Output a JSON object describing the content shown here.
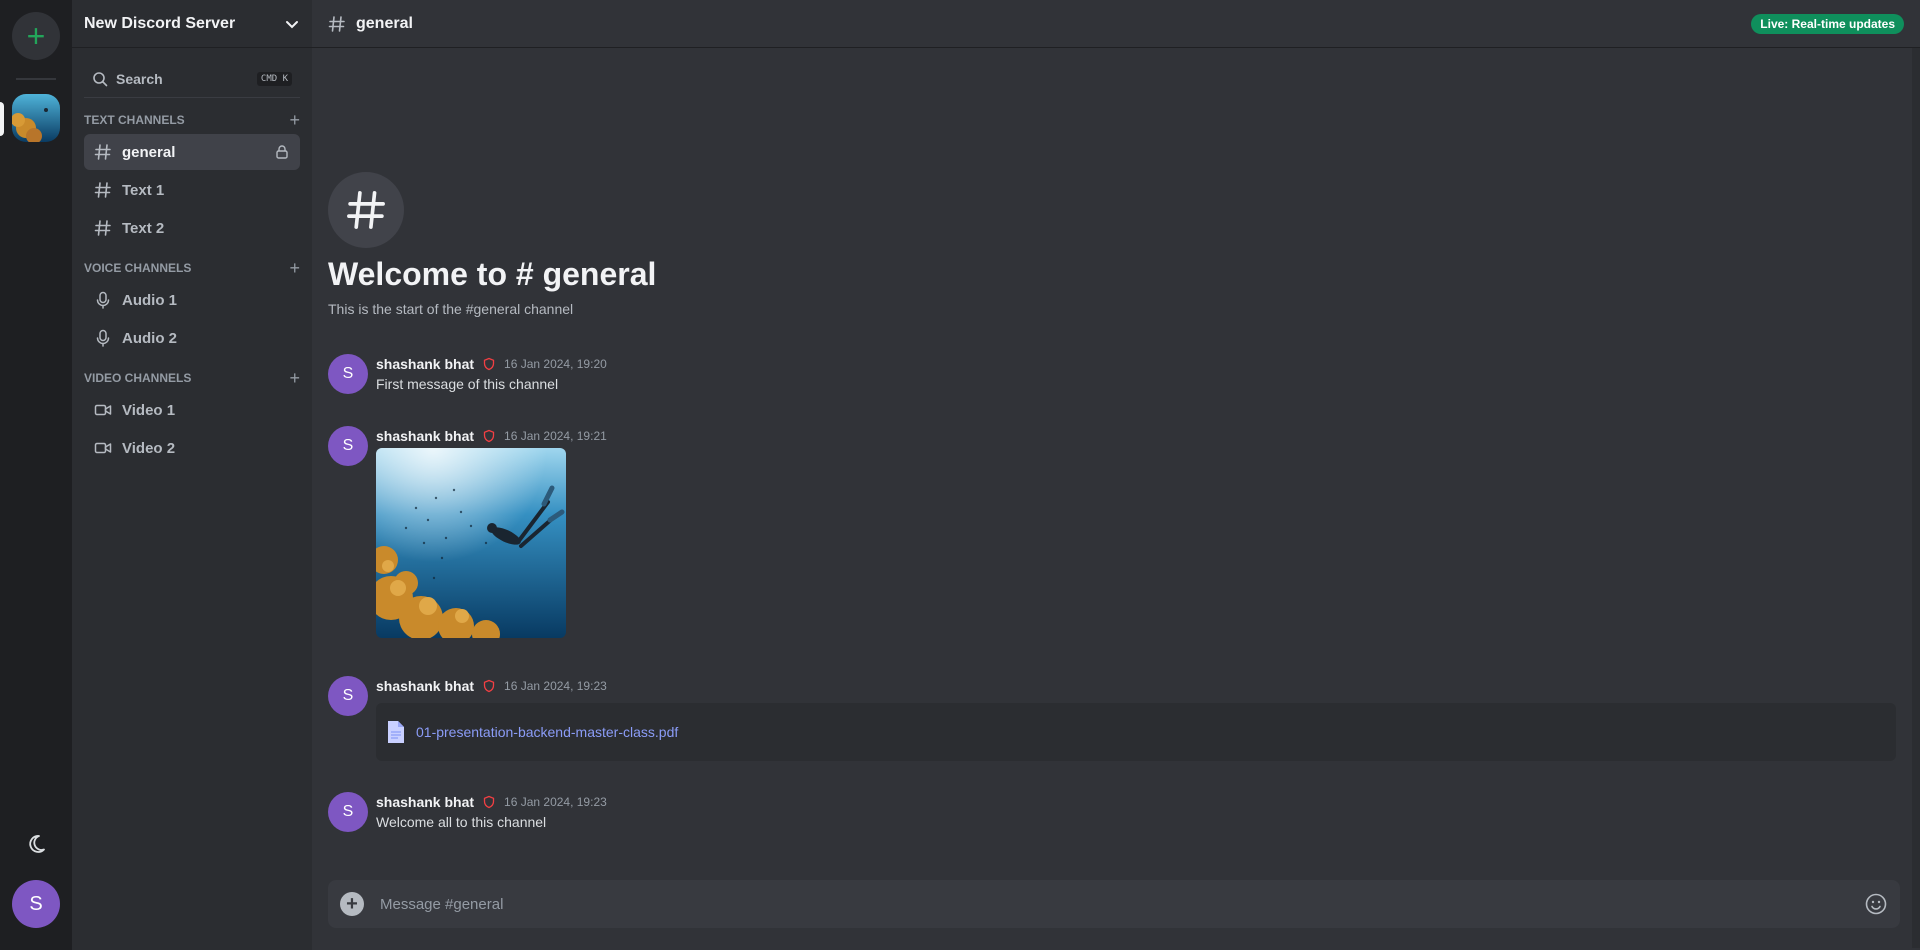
{
  "rail": {
    "add_icon": "plus-icon",
    "user_initial": "S",
    "theme_icon": "moon-icon"
  },
  "server": {
    "name": "New Discord Server",
    "search_label": "Search",
    "search_shortcut": "CMD K"
  },
  "sections": {
    "text": {
      "title": "TEXT CHANNELS",
      "channels": [
        {
          "label": "general"
        },
        {
          "label": "Text 1"
        },
        {
          "label": "Text 2"
        }
      ]
    },
    "voice": {
      "title": "VOICE CHANNELS",
      "channels": [
        {
          "label": "Audio 1"
        },
        {
          "label": "Audio 2"
        }
      ]
    },
    "video": {
      "title": "VIDEO CHANNELS",
      "channels": [
        {
          "label": "Video 1"
        },
        {
          "label": "Video 2"
        }
      ]
    }
  },
  "header": {
    "channel": "general",
    "live_badge": "Live: Real-time updates"
  },
  "welcome": {
    "title": "Welcome to # general",
    "subtitle": "This is the start of the #general channel"
  },
  "messages": [
    {
      "initial": "S",
      "author": "shashank bhat",
      "time": "16 Jan 2024, 19:20",
      "text": "First message of this channel"
    },
    {
      "initial": "S",
      "author": "shashank bhat",
      "time": "16 Jan 2024, 19:21",
      "attachment": "image"
    },
    {
      "initial": "S",
      "author": "shashank bhat",
      "time": "16 Jan 2024, 19:23",
      "file": "01-presentation-backend-master-class.pdf"
    },
    {
      "initial": "S",
      "author": "shashank bhat",
      "time": "16 Jan 2024, 19:23",
      "text": "Welcome all to this channel"
    }
  ],
  "composer": {
    "placeholder": "Message #general"
  },
  "colors": {
    "accent_green": "#23a55a",
    "live_badge": "#0f8f5c",
    "avatar": "#7e57c2",
    "link": "#8b9cf7",
    "moderator_shield": "#f23f43"
  }
}
